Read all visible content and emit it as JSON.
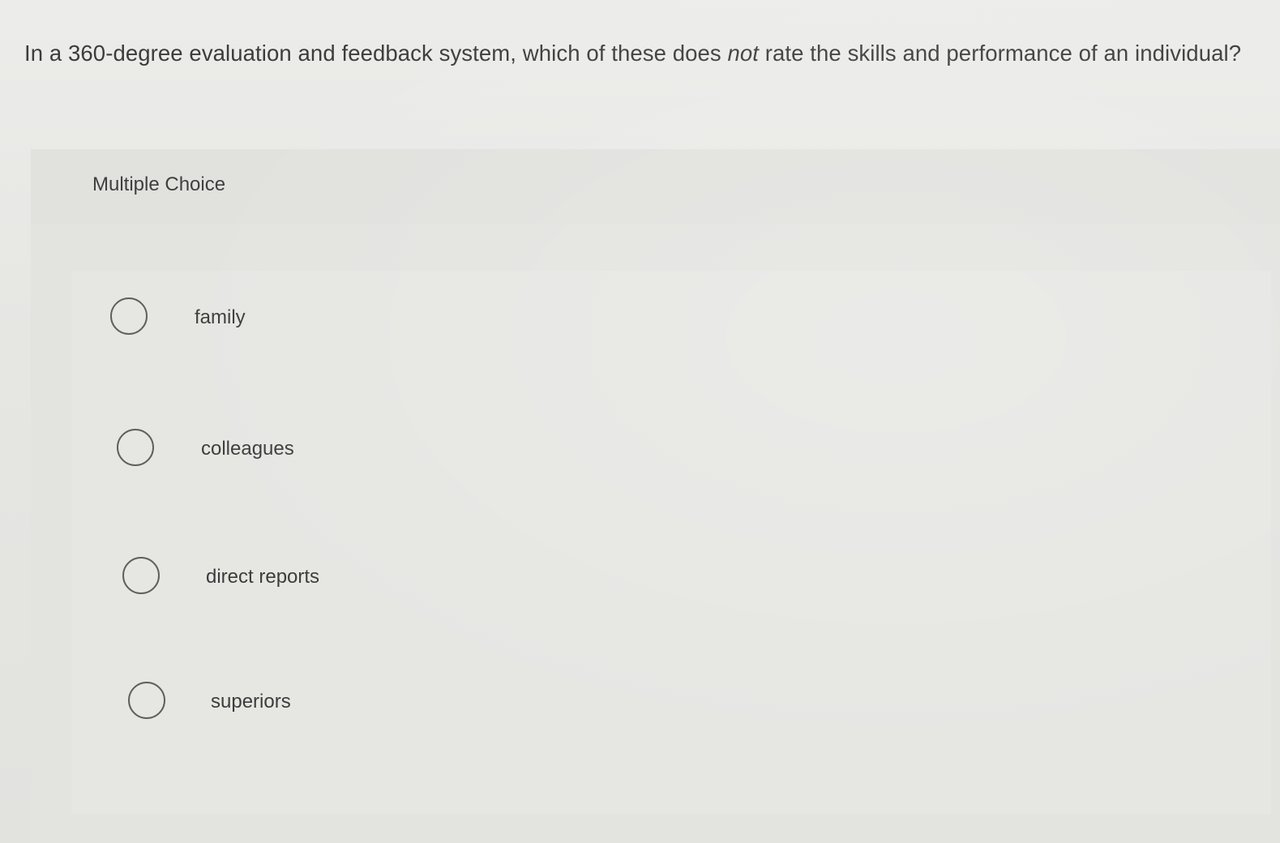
{
  "question": {
    "text_before": "In a 360-degree evaluation and feedback system, which of these does ",
    "emphasis": "not",
    "text_after": " rate the skills and performance of an individual?"
  },
  "panel": {
    "label": "Multiple Choice"
  },
  "options": [
    {
      "label": "family",
      "selected": false
    },
    {
      "label": "colleagues",
      "selected": false
    },
    {
      "label": "direct reports",
      "selected": false
    },
    {
      "label": "superiors",
      "selected": false
    }
  ]
}
